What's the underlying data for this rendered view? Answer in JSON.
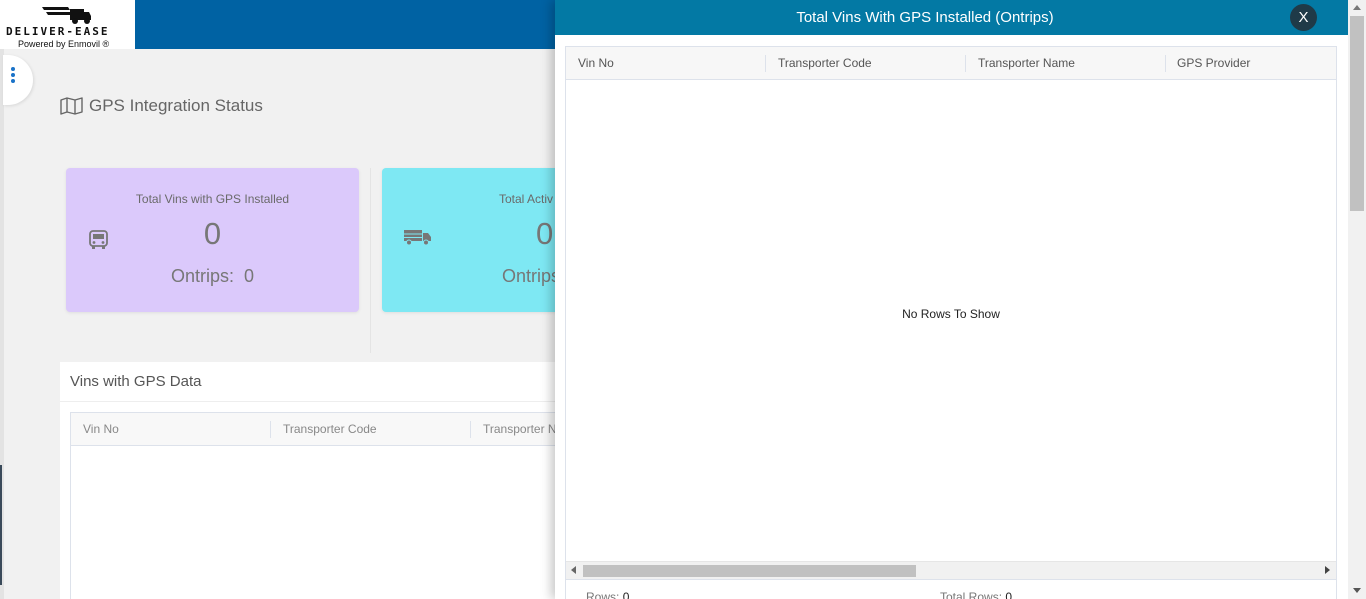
{
  "app": {
    "logo_text": "DELIVER-EASE",
    "powered_by": "Powered by Enmovil ®"
  },
  "page": {
    "title": "GPS Integration Status",
    "title_icon": "map-icon"
  },
  "cards": [
    {
      "title": "Total Vins with GPS Installed",
      "value": "0",
      "sub_label": "Ontrips:",
      "sub_value": "0",
      "icon": "bus-icon",
      "color": "#dbc9fb"
    },
    {
      "title": "Total Activ",
      "value": "0",
      "sub_label": "Ontrips",
      "icon": "truck-icon",
      "color": "#7ee8f3"
    }
  ],
  "vins_panel": {
    "title": "Vins with GPS Data",
    "columns": [
      "Vin No",
      "Transporter Code",
      "Transporter N"
    ]
  },
  "overlay": {
    "title": "Total Vins With GPS Installed (Ontrips)",
    "close_label": "X",
    "header_color": "#0379a4",
    "grid": {
      "columns": [
        "Vin No",
        "Transporter Code",
        "Transporter Name",
        "GPS Provider"
      ],
      "empty_message": "No Rows To Show",
      "footer": {
        "rows_label": "Rows:",
        "rows_value": "0",
        "total_label": "Total Rows:",
        "total_value": "0"
      }
    }
  }
}
